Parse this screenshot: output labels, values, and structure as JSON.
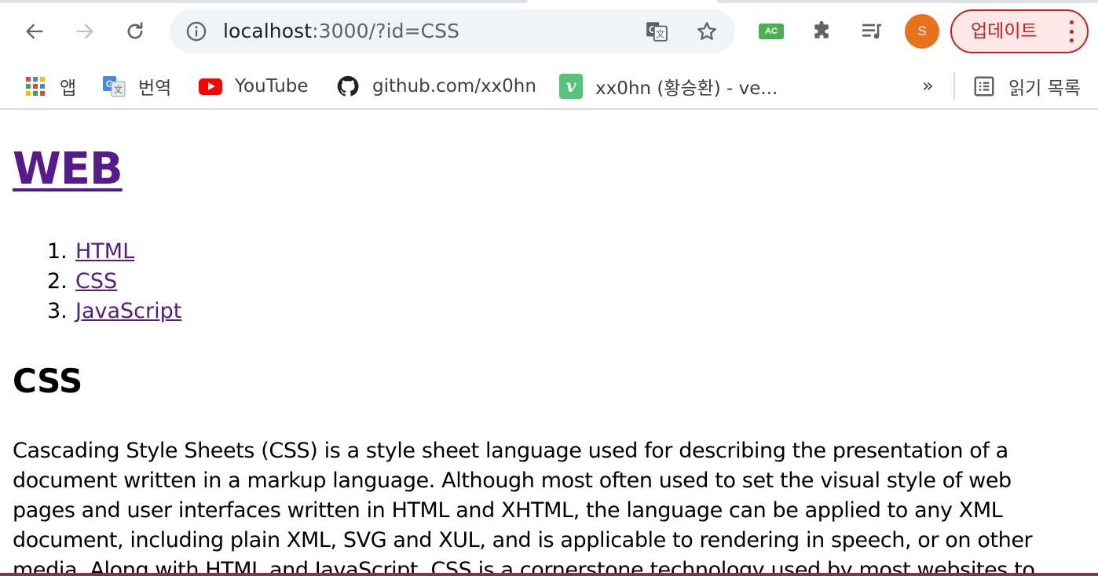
{
  "browser": {
    "nav": {
      "back_icon": "arrow-left-icon",
      "forward_icon": "arrow-right-icon",
      "reload_icon": "reload-icon"
    },
    "omnibox": {
      "info_icon": "info-icon",
      "url_host": "localhost",
      "url_rest": ":3000/?id=CSS",
      "translate_icon": "translate-icon",
      "star_icon": "star-icon"
    },
    "extensions": {
      "ac_label": "AC",
      "puzzle_icon": "puzzle-icon",
      "media_icon": "playlist-icon"
    },
    "profile": {
      "initial": "S",
      "color": "#e8711c"
    },
    "update_button": {
      "label": "업데이트",
      "color": "#c5221f"
    }
  },
  "bookmarks": {
    "items": [
      {
        "label": "앱",
        "icon": "apps-grid-icon"
      },
      {
        "label": "번역",
        "icon": "google-translate-icon"
      },
      {
        "label": "YouTube",
        "icon": "youtube-icon"
      },
      {
        "label": "github.com/xx0hn",
        "icon": "github-icon"
      },
      {
        "label": "xx0hn (황승환) - ve...",
        "icon": "velog-icon"
      }
    ],
    "overflow": "»",
    "reading_list": {
      "label": "읽기 목록",
      "icon": "reading-list-icon"
    }
  },
  "page": {
    "title": "WEB",
    "nav_list": [
      {
        "num": "1.",
        "label": "HTML"
      },
      {
        "num": "2.",
        "label": "CSS"
      },
      {
        "num": "3.",
        "label": "JavaScript"
      }
    ],
    "heading": "CSS",
    "body": "Cascading Style Sheets (CSS) is a style sheet language used for describing the presentation of a document written in a markup language. Although most often used to set the visual style of web pages and user interfaces written in HTML and XHTML, the language can be applied to any XML document, including plain XML, SVG and XUL, and is applicable to rendering in speech, or on other media. Along with HTML and JavaScript, CSS is a cornerstone technology used by most websites to",
    "link_color": "#551a8b"
  }
}
